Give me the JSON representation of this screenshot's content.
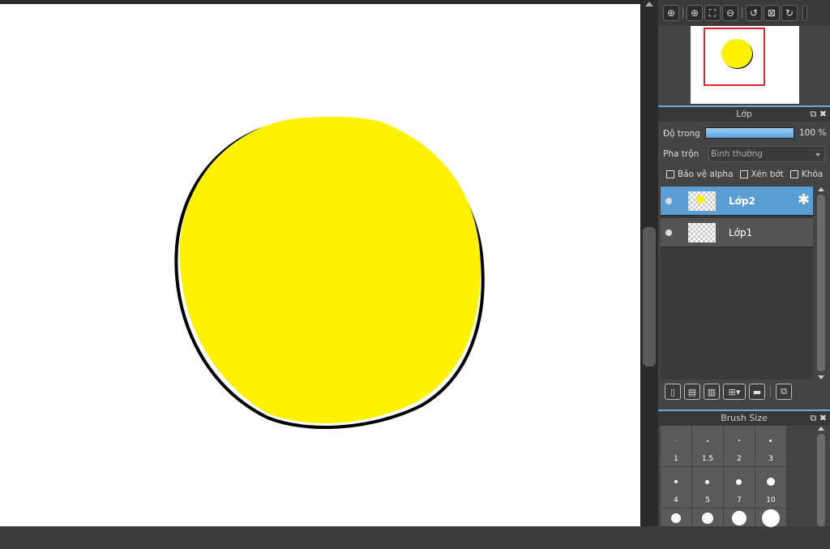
{
  "navigator": {
    "tools": [
      "zoom-in-icon",
      "zoom-fit-icon",
      "zoom-out-icon",
      "rotate-ccw-icon",
      "flip-icon",
      "rotate-cw-icon"
    ]
  },
  "layer_panel": {
    "title": "Lớp",
    "opacity_label": "Độ trong",
    "opacity_value": "100 %",
    "opacity_fraction": 1.0,
    "blend_label": "Pha trộn",
    "blend_value": "Bình thường",
    "protect_alpha": "Bảo vệ alpha",
    "clipping": "Xén bớt",
    "lock": "Khóa",
    "layers": [
      {
        "name": "Lớp2",
        "active": true
      },
      {
        "name": "Lớp1",
        "active": false
      }
    ]
  },
  "brush_panel": {
    "title": "Brush Size",
    "sizes": [
      "1",
      "1.5",
      "2",
      "3",
      "4",
      "5",
      "7",
      "10"
    ]
  },
  "colors": {
    "fill": "#fff200",
    "accent": "#5a9ed6",
    "nav_frame": "#e0242c"
  }
}
